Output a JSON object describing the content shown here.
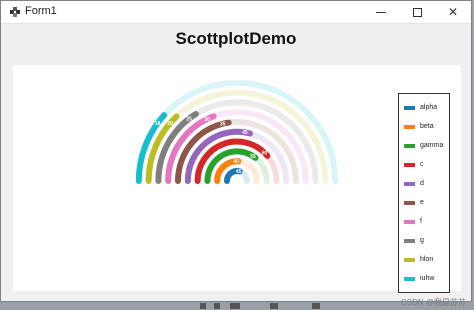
{
  "window": {
    "title": "Form1",
    "app_icon": "winforms-app-icon",
    "minimize_icon": "minimize-icon",
    "maximize_icon": "maximize-icon",
    "close_icon": "close-icon",
    "close_glyph": "✕"
  },
  "heading": "ScottplotDemo",
  "watermark": "CSDN @我是苏苏",
  "chart_data": {
    "type": "radial-gauge",
    "start_angle_deg": 180,
    "sweep_deg": 180,
    "background_track": true,
    "series": [
      {
        "name": "alpha",
        "value": 45,
        "color": "#1f77b4"
      },
      {
        "name": "beta",
        "value": 40,
        "color": "#ff7f0e"
      },
      {
        "name": "gamma",
        "value": 55,
        "color": "#2ca02c"
      },
      {
        "name": "c",
        "value": 60,
        "color": "#d62728"
      },
      {
        "name": "d",
        "value": 45,
        "color": "#9467bd"
      },
      {
        "name": "e",
        "value": 35,
        "color": "#8c564b"
      },
      {
        "name": "f",
        "value": 30,
        "color": "#e377c2"
      },
      {
        "name": "g",
        "value": 25,
        "color": "#7f7f7f"
      },
      {
        "name": "hlon",
        "value": 20,
        "color": "#bcbd22"
      },
      {
        "name": "iuhw",
        "value": 18,
        "color": "#17becf"
      }
    ],
    "data_labels": [
      "45",
      "40",
      "55",
      "60",
      "45",
      "35",
      "30",
      "25",
      "20",
      "18"
    ],
    "legend_position": "right"
  }
}
